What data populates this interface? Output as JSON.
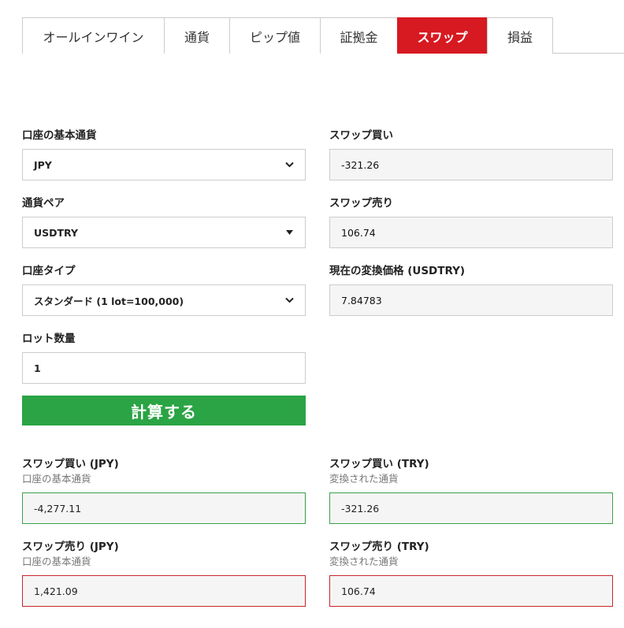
{
  "tabs": [
    {
      "label": "オールインワイン",
      "active": false
    },
    {
      "label": "通貨",
      "active": false
    },
    {
      "label": "ピップ値",
      "active": false
    },
    {
      "label": "証拠金",
      "active": false
    },
    {
      "label": "スワップ",
      "active": true
    },
    {
      "label": "損益",
      "active": false
    }
  ],
  "form": {
    "base_currency": {
      "label": "口座の基本通貨",
      "value": "JPY"
    },
    "currency_pair": {
      "label": "通貨ペア",
      "value": "USDTRY"
    },
    "account_type": {
      "label": "口座タイプ",
      "value": "スタンダード (1 lot=100,000)"
    },
    "lot_size": {
      "label": "ロット数量",
      "value": "1"
    },
    "swap_buy": {
      "label": "スワップ買い",
      "value": "-321.26"
    },
    "swap_sell": {
      "label": "スワップ売り",
      "value": "106.74"
    },
    "conversion_rate": {
      "label": "現在の変換価格 (USDTRY)",
      "value": "7.84783"
    }
  },
  "calculate_button": {
    "label": "計算する"
  },
  "results": {
    "swap_buy_base": {
      "label": "スワップ買い (JPY)",
      "sublabel": "口座の基本通貨",
      "value": "-4,277.11"
    },
    "swap_buy_quote": {
      "label": "スワップ買い (TRY)",
      "sublabel": "変換された通貨",
      "value": "-321.26"
    },
    "swap_sell_base": {
      "label": "スワップ売り (JPY)",
      "sublabel": "口座の基本通貨",
      "value": "1,421.09"
    },
    "swap_sell_quote": {
      "label": "スワップ売り (TRY)",
      "sublabel": "変換された通貨",
      "value": "106.74"
    }
  },
  "colors": {
    "accent_red": "#d71921",
    "button_green": "#2aa444",
    "positive_border": "#3aa14a",
    "negative_border": "#c8262c"
  },
  "icons": {
    "select_chevron": "chevron-down-icon",
    "select_caret": "caret-down-icon"
  }
}
